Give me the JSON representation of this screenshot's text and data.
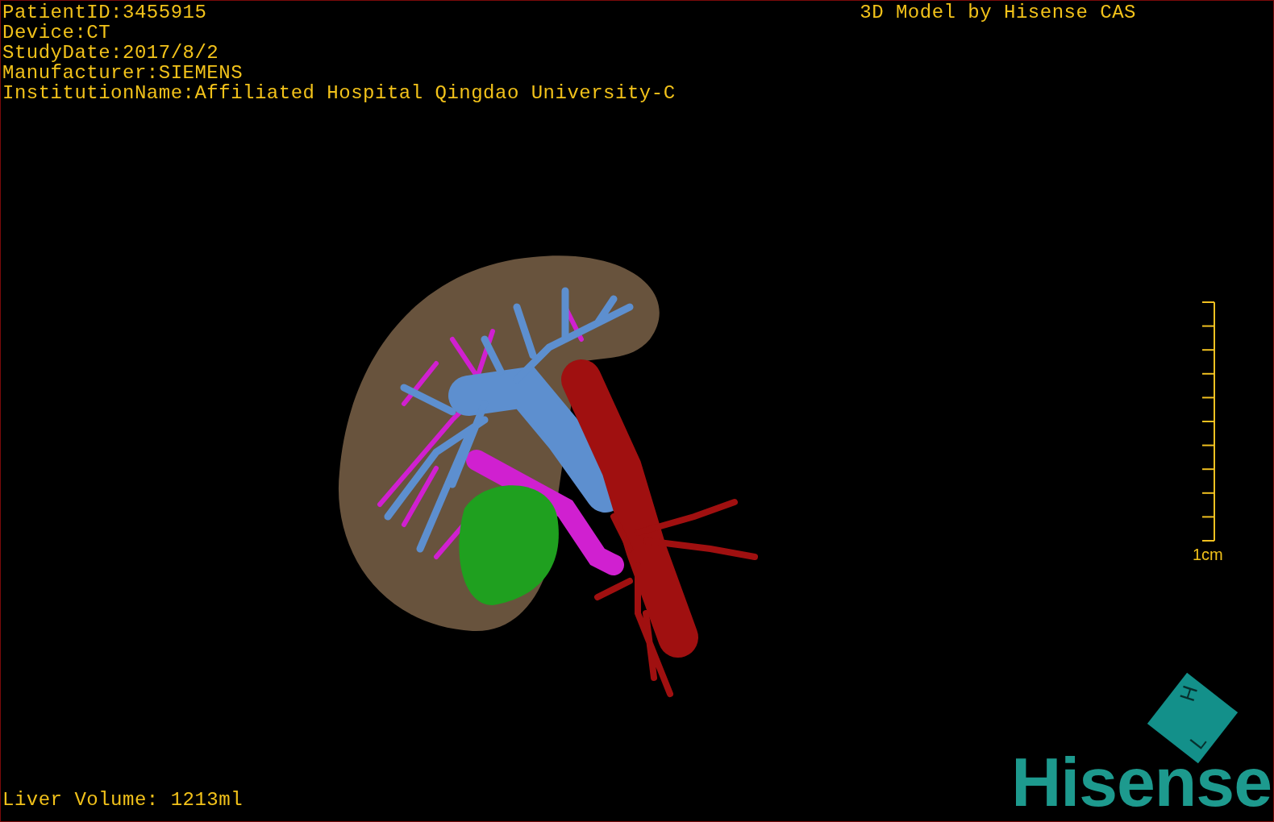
{
  "overlay": {
    "top_left": [
      "PatientID:3455915",
      "Device:CT",
      "StudyDate:2017/8/2",
      "Manufacturer:SIEMENS",
      "InstitutionName:Affiliated Hospital Qingdao University-C"
    ],
    "top_right": "3D Model by Hisense CAS",
    "bottom_left": "Liver Volume: 1213ml"
  },
  "scale_bar": {
    "label": "1cm"
  },
  "orientation_cube": {
    "faces": [
      "H",
      "L"
    ]
  },
  "logo": {
    "text": "Hisense"
  }
}
